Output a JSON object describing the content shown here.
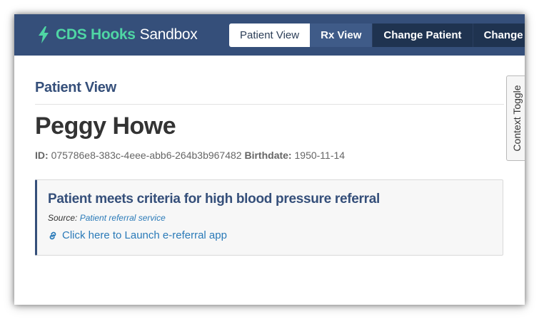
{
  "header": {
    "brand_accent": "CDS Hooks",
    "brand_rest": "Sandbox",
    "nav": {
      "patient_view": "Patient View",
      "rx_view": "Rx View",
      "change_patient": "Change Patient",
      "change_fhir": "Change FHIR"
    }
  },
  "main": {
    "section_title": "Patient View",
    "patient": {
      "name": "Peggy Howe",
      "id_label": "ID:",
      "id_value": "075786e8-383c-4eee-abb6-264b3b967482",
      "birthdate_label": "Birthdate:",
      "birthdate_value": "1950-11-14"
    },
    "card": {
      "title": "Patient meets criteria for high blood pressure referral",
      "source_label": "Source:",
      "source_link": "Patient referral service",
      "action_label": "Click here to Launch e-referral app"
    }
  },
  "context_toggle": {
    "label": "Context Toggle"
  },
  "icons": {
    "brand": "bolt-icon",
    "action": "link-icon"
  },
  "colors": {
    "header_bg": "#354f7a",
    "brand_accent": "#4fd6a4",
    "title": "#354f7a",
    "link": "#2a7ab8"
  }
}
